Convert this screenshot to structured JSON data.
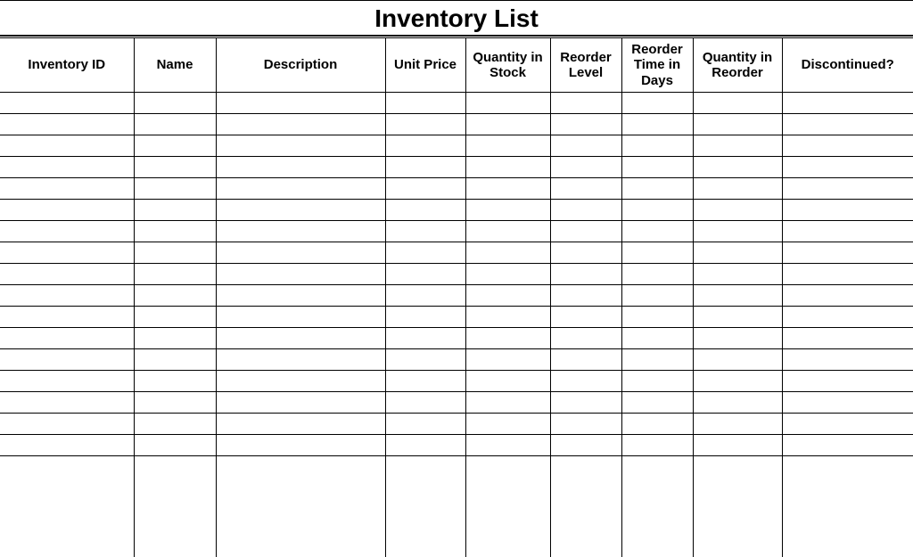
{
  "title": "Inventory List",
  "columns": [
    "Inventory ID",
    "Name",
    "Description",
    "Unit Price",
    "Quantity in Stock",
    "Reorder Level",
    "Reorder Time in Days",
    "Quantity in Reorder",
    "Discontinued?"
  ],
  "rows": [
    [
      "",
      "",
      "",
      "",
      "",
      "",
      "",
      "",
      ""
    ],
    [
      "",
      "",
      "",
      "",
      "",
      "",
      "",
      "",
      ""
    ],
    [
      "",
      "",
      "",
      "",
      "",
      "",
      "",
      "",
      ""
    ],
    [
      "",
      "",
      "",
      "",
      "",
      "",
      "",
      "",
      ""
    ],
    [
      "",
      "",
      "",
      "",
      "",
      "",
      "",
      "",
      ""
    ],
    [
      "",
      "",
      "",
      "",
      "",
      "",
      "",
      "",
      ""
    ],
    [
      "",
      "",
      "",
      "",
      "",
      "",
      "",
      "",
      ""
    ],
    [
      "",
      "",
      "",
      "",
      "",
      "",
      "",
      "",
      ""
    ],
    [
      "",
      "",
      "",
      "",
      "",
      "",
      "",
      "",
      ""
    ],
    [
      "",
      "",
      "",
      "",
      "",
      "",
      "",
      "",
      ""
    ],
    [
      "",
      "",
      "",
      "",
      "",
      "",
      "",
      "",
      ""
    ],
    [
      "",
      "",
      "",
      "",
      "",
      "",
      "",
      "",
      ""
    ],
    [
      "",
      "",
      "",
      "",
      "",
      "",
      "",
      "",
      ""
    ],
    [
      "",
      "",
      "",
      "",
      "",
      "",
      "",
      "",
      ""
    ],
    [
      "",
      "",
      "",
      "",
      "",
      "",
      "",
      "",
      ""
    ],
    [
      "",
      "",
      "",
      "",
      "",
      "",
      "",
      "",
      ""
    ],
    [
      "",
      "",
      "",
      "",
      "",
      "",
      "",
      "",
      ""
    ]
  ]
}
